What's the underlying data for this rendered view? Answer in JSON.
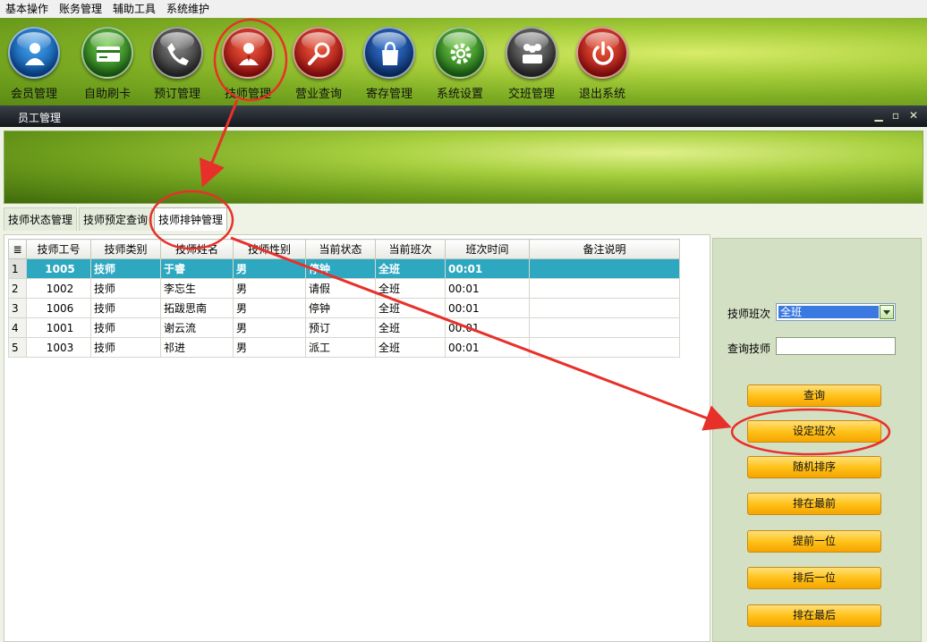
{
  "menu": [
    "基本操作",
    "账务管理",
    "辅助工具",
    "系统维护"
  ],
  "toolbar": [
    {
      "label": "会员管理",
      "icon": "member-icon",
      "color": "blue"
    },
    {
      "label": "自助刷卡",
      "icon": "card-icon",
      "color": "green"
    },
    {
      "label": "预订管理",
      "icon": "phone-icon",
      "color": "gray"
    },
    {
      "label": "技师管理",
      "icon": "technician-icon",
      "color": "red"
    },
    {
      "label": "营业查询",
      "icon": "magnifier-icon",
      "color": "red"
    },
    {
      "label": "寄存管理",
      "icon": "bag-icon",
      "color": "navy"
    },
    {
      "label": "系统设置",
      "icon": "gear-icon",
      "color": "green"
    },
    {
      "label": "交班管理",
      "icon": "shift-handover-icon",
      "color": "gray"
    },
    {
      "label": "退出系统",
      "icon": "power-icon",
      "color": "red"
    }
  ],
  "window": {
    "title": "员工管理"
  },
  "tabs": [
    "技师状态管理",
    "技师预定查询",
    "技师排钟管理"
  ],
  "grid": {
    "columns": [
      "技师工号",
      "技师类别",
      "技师姓名",
      "技师性别",
      "当前状态",
      "当前班次",
      "班次时间",
      "备注说明"
    ],
    "rows": [
      {
        "n": "1",
        "cells": [
          "1005",
          "技师",
          "于睿",
          "男",
          "停钟",
          "全班",
          "00:01",
          ""
        ]
      },
      {
        "n": "2",
        "cells": [
          "1002",
          "技师",
          "李忘生",
          "男",
          "请假",
          "全班",
          "00:01",
          ""
        ]
      },
      {
        "n": "3",
        "cells": [
          "1006",
          "技师",
          "拓跋思南",
          "男",
          "停钟",
          "全班",
          "00:01",
          ""
        ]
      },
      {
        "n": "4",
        "cells": [
          "1001",
          "技师",
          "谢云流",
          "男",
          "预订",
          "全班",
          "00:01",
          ""
        ]
      },
      {
        "n": "5",
        "cells": [
          "1003",
          "技师",
          "祁进",
          "男",
          "派工",
          "全班",
          "00:01",
          ""
        ]
      }
    ]
  },
  "panel": {
    "shift_label": "技师班次",
    "shift_value": "全班",
    "query_label": "查询技师",
    "query_value": "",
    "buttons": [
      "查询",
      "设定班次",
      "随机排序",
      "排在最前",
      "提前一位",
      "排后一位",
      "排在最后"
    ]
  },
  "colors": {
    "selected_row": "#2ea8c0",
    "button": "#ffc21a",
    "annotation": "#e8302a"
  }
}
